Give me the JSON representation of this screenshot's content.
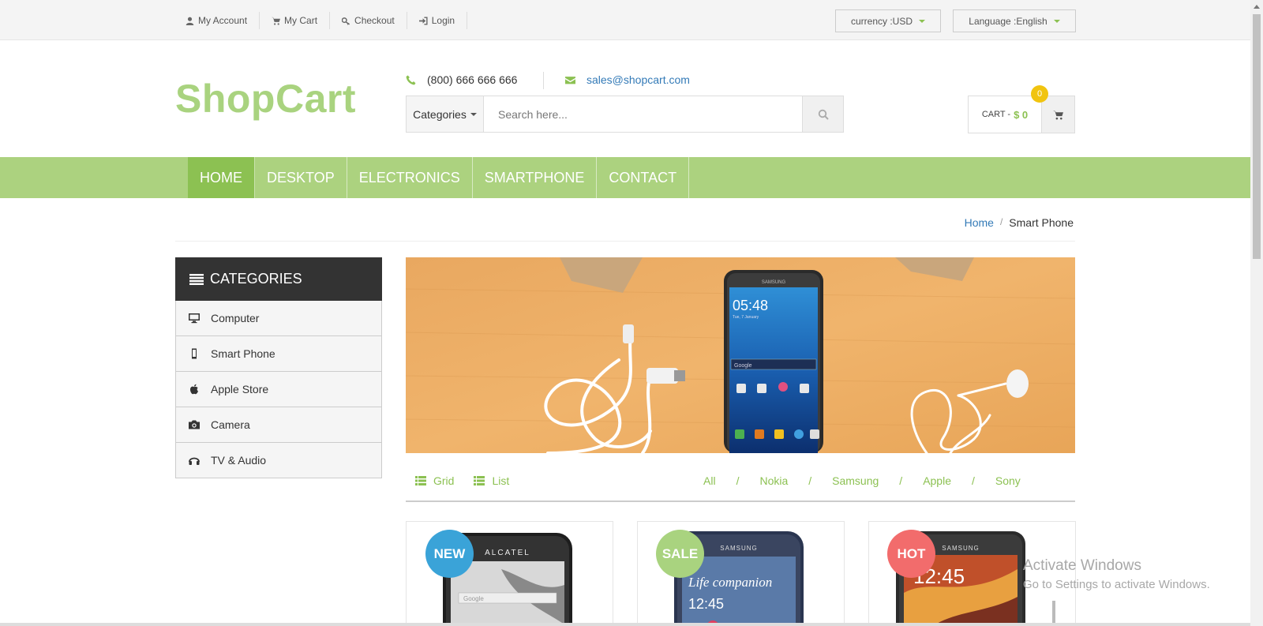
{
  "topbar": {
    "links": [
      {
        "label": "My Account",
        "icon": "user-icon"
      },
      {
        "label": "My Cart",
        "icon": "cart-icon"
      },
      {
        "label": "Checkout",
        "icon": "key-icon"
      },
      {
        "label": "Login",
        "icon": "sign-in-icon"
      }
    ],
    "currency_label": "currency :USD",
    "language_label": "Language :English"
  },
  "header": {
    "logo": "ShopCart",
    "phone": "(800) 666 666 666",
    "email": "sales@shopcart.com",
    "search": {
      "category_label": "Categories",
      "placeholder": "Search here..."
    },
    "cart": {
      "label": "CART -",
      "total": "$ 0",
      "count": "0"
    }
  },
  "nav": {
    "items": [
      "HOME",
      "DESKTOP",
      "ELECTRONICS",
      "SMARTPHONE",
      "CONTACT"
    ],
    "active": "HOME"
  },
  "breadcrumb": {
    "home": "Home",
    "separator": "/",
    "current": "Smart Phone"
  },
  "sidebar": {
    "title": "CATEGORIES",
    "items": [
      {
        "label": "Computer",
        "icon": "desktop-icon"
      },
      {
        "label": "Smart Phone",
        "icon": "mobile-icon"
      },
      {
        "label": "Apple Store",
        "icon": "apple-icon"
      },
      {
        "label": "Camera",
        "icon": "camera-icon"
      },
      {
        "label": "TV & Audio",
        "icon": "headphones-icon"
      }
    ]
  },
  "banner": {
    "phone_brand": "SAMSUNG",
    "phone_time": "05:48",
    "phone_date": "Tue, 7 January",
    "phone_search": "Google"
  },
  "view_toggle": {
    "grid": "Grid",
    "list": "List"
  },
  "filters": [
    "All",
    "Nokia",
    "Samsung",
    "Apple",
    "Sony"
  ],
  "products": [
    {
      "badge": "NEW",
      "badge_color": "#3aa3d8",
      "brand": "ALCATEL",
      "screen_text": "Google"
    },
    {
      "badge": "SALE",
      "badge_color": "#a9d37f",
      "brand": "SAMSUNG",
      "screen_text": "Life companion",
      "screen_time": "12:45"
    },
    {
      "badge": "HOT",
      "badge_color": "#f26c6c",
      "brand": "SAMSUNG",
      "screen_time": "12:45"
    }
  ],
  "watermark": {
    "line1": "Activate Windows",
    "line2": "Go to Settings to activate Windows."
  },
  "colors": {
    "accent": "#8cc152",
    "nav_bg": "#acd27f",
    "logo": "#a9d37f",
    "badge_count": "#f1c40f",
    "sidebar_head": "#333333"
  }
}
